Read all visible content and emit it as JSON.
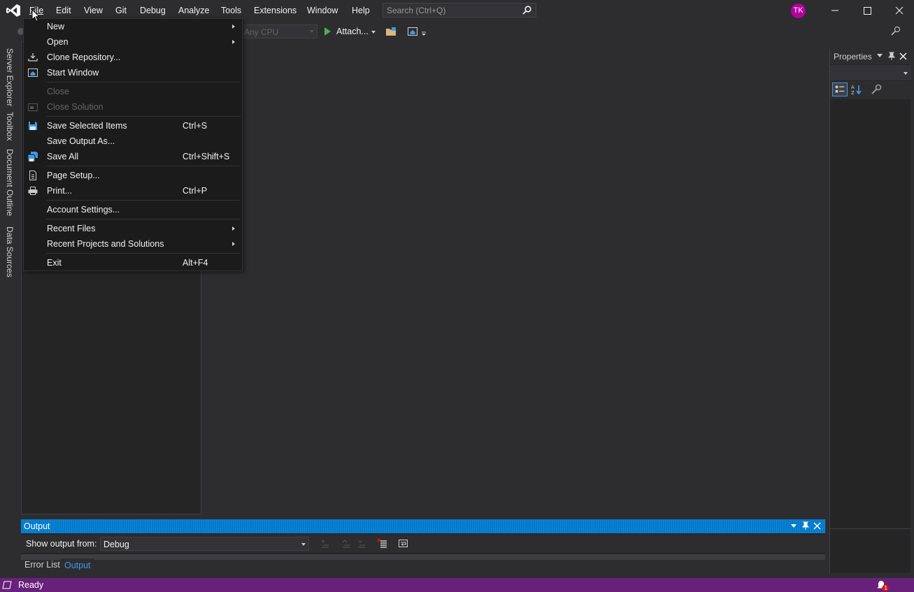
{
  "menubar": {
    "items": [
      "File",
      "Edit",
      "View",
      "Git",
      "Debug",
      "Analyze",
      "Tools",
      "Extensions",
      "Window",
      "Help"
    ]
  },
  "search": {
    "placeholder": "Search (Ctrl+Q)"
  },
  "user": {
    "initials": "TK"
  },
  "toolbar": {
    "platform": "Any CPU",
    "attach_label": "Attach..."
  },
  "left_tabs": [
    "Server Explorer",
    "Toolbox",
    "Document Outline",
    "Data Sources"
  ],
  "properties": {
    "title": "Properties"
  },
  "output": {
    "title": "Output",
    "show_output_label": "Show output from:",
    "source": "Debug"
  },
  "bottom_tabs": {
    "error_list": "Error List",
    "output": "Output"
  },
  "status": {
    "text": "Ready",
    "notifications": "1"
  },
  "file_menu": {
    "items": [
      {
        "label": "New",
        "submenu": true
      },
      {
        "label": "Open",
        "submenu": true
      },
      {
        "label": "Clone Repository...",
        "icon": "download-icon"
      },
      {
        "label": "Start Window",
        "icon": "home-window-icon"
      },
      {
        "label": "Close",
        "disabled": true
      },
      {
        "label": "Close Solution",
        "disabled": true,
        "icon": "close-solution-icon"
      },
      {
        "label": "Save Selected Items",
        "shortcut": "Ctrl+S",
        "icon": "save-icon"
      },
      {
        "label": "Save Output As..."
      },
      {
        "label": "Save All",
        "shortcut": "Ctrl+Shift+S",
        "icon": "save-all-icon"
      },
      {
        "label": "Page Setup...",
        "icon": "page-setup-icon"
      },
      {
        "label": "Print...",
        "shortcut": "Ctrl+P",
        "icon": "print-icon"
      },
      {
        "label": "Account Settings..."
      },
      {
        "label": "Recent Files",
        "submenu": true
      },
      {
        "label": "Recent Projects and Solutions",
        "submenu": true
      },
      {
        "label": "Exit",
        "shortcut": "Alt+F4"
      }
    ]
  },
  "colors": {
    "accent": "#007acc",
    "status_bar": "#68217a",
    "avatar": "#b4009e",
    "background": "#2d2d30"
  }
}
